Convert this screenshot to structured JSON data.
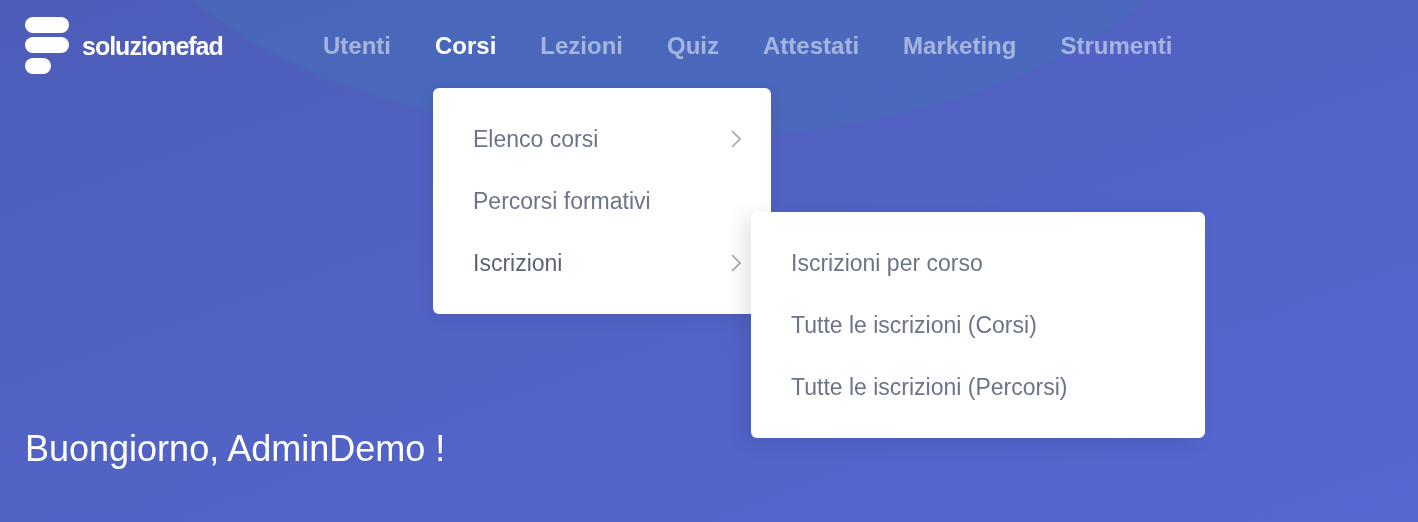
{
  "logo": {
    "text": "soluzionefad"
  },
  "nav": [
    {
      "label": "Utenti",
      "selected": false
    },
    {
      "label": "Corsi",
      "selected": true
    },
    {
      "label": "Lezioni",
      "selected": false
    },
    {
      "label": "Quiz",
      "selected": false
    },
    {
      "label": "Attestati",
      "selected": false
    },
    {
      "label": "Marketing",
      "selected": false
    },
    {
      "label": "Strumenti",
      "selected": false
    }
  ],
  "dropdown": {
    "items": [
      {
        "label": "Elenco corsi",
        "has_submenu": true,
        "expanded": false
      },
      {
        "label": "Percorsi formativi",
        "has_submenu": false,
        "expanded": false
      },
      {
        "label": "Iscrizioni",
        "has_submenu": true,
        "expanded": true,
        "children": [
          {
            "label": "Iscrizioni per corso"
          },
          {
            "label": "Tutte le iscrizioni (Corsi)"
          },
          {
            "label": "Tutte le iscrizioni (Percorsi)"
          }
        ]
      }
    ]
  },
  "greeting": "Buongiorno, AdminDemo !"
}
